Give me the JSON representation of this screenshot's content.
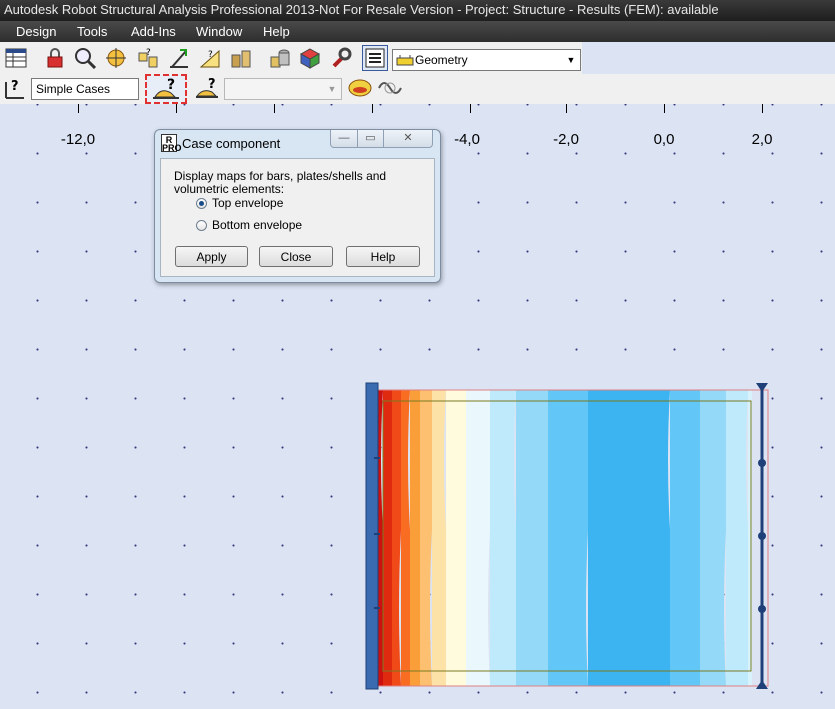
{
  "window": {
    "title": "Autodesk Robot Structural Analysis Professional 2013-Not For Resale Version - Project: Structure - Results (FEM): available"
  },
  "menu": {
    "items": [
      "Design",
      "Tools",
      "Add-Ins",
      "Window",
      "Help"
    ]
  },
  "toolbar": {
    "view_combo_value": "Geometry",
    "case_combo_value": "Simple Cases",
    "component_combo_value": ""
  },
  "ruler": {
    "labels": [
      "-12,0",
      "-4,0",
      "-2,0",
      "0,0",
      "2,0"
    ]
  },
  "dialog": {
    "title": "Case component",
    "description": "Display maps for bars, plates/shells and volumetric elements:",
    "options": [
      {
        "label": "Top envelope",
        "selected": true
      },
      {
        "label": "Bottom envelope",
        "selected": false
      }
    ],
    "buttons": {
      "apply": "Apply",
      "close": "Close",
      "help": "Help"
    },
    "controls": {
      "minimize": "—",
      "maximize": "▭",
      "close": "✕"
    },
    "logo_text": "R PRO"
  },
  "map": {
    "band_colors": [
      "#cc1010",
      "#e02a10",
      "#f04a18",
      "#f86d22",
      "#fa9e3a",
      "#fcc070",
      "#fde2a8",
      "#fffbdc",
      "#eaf8fe",
      "#bfeafc",
      "#94daf8",
      "#62c6f6",
      "#3cb4f2",
      "#62c6f6",
      "#94daf8",
      "#bfeafc",
      "#d8f2fc"
    ],
    "contour_color": "#7a7a20",
    "support_color": "#3a6bb0"
  },
  "colors": {
    "titlebar": "#2a2a2a",
    "canvas": "#dce4f4",
    "highlight": "#e03030"
  }
}
